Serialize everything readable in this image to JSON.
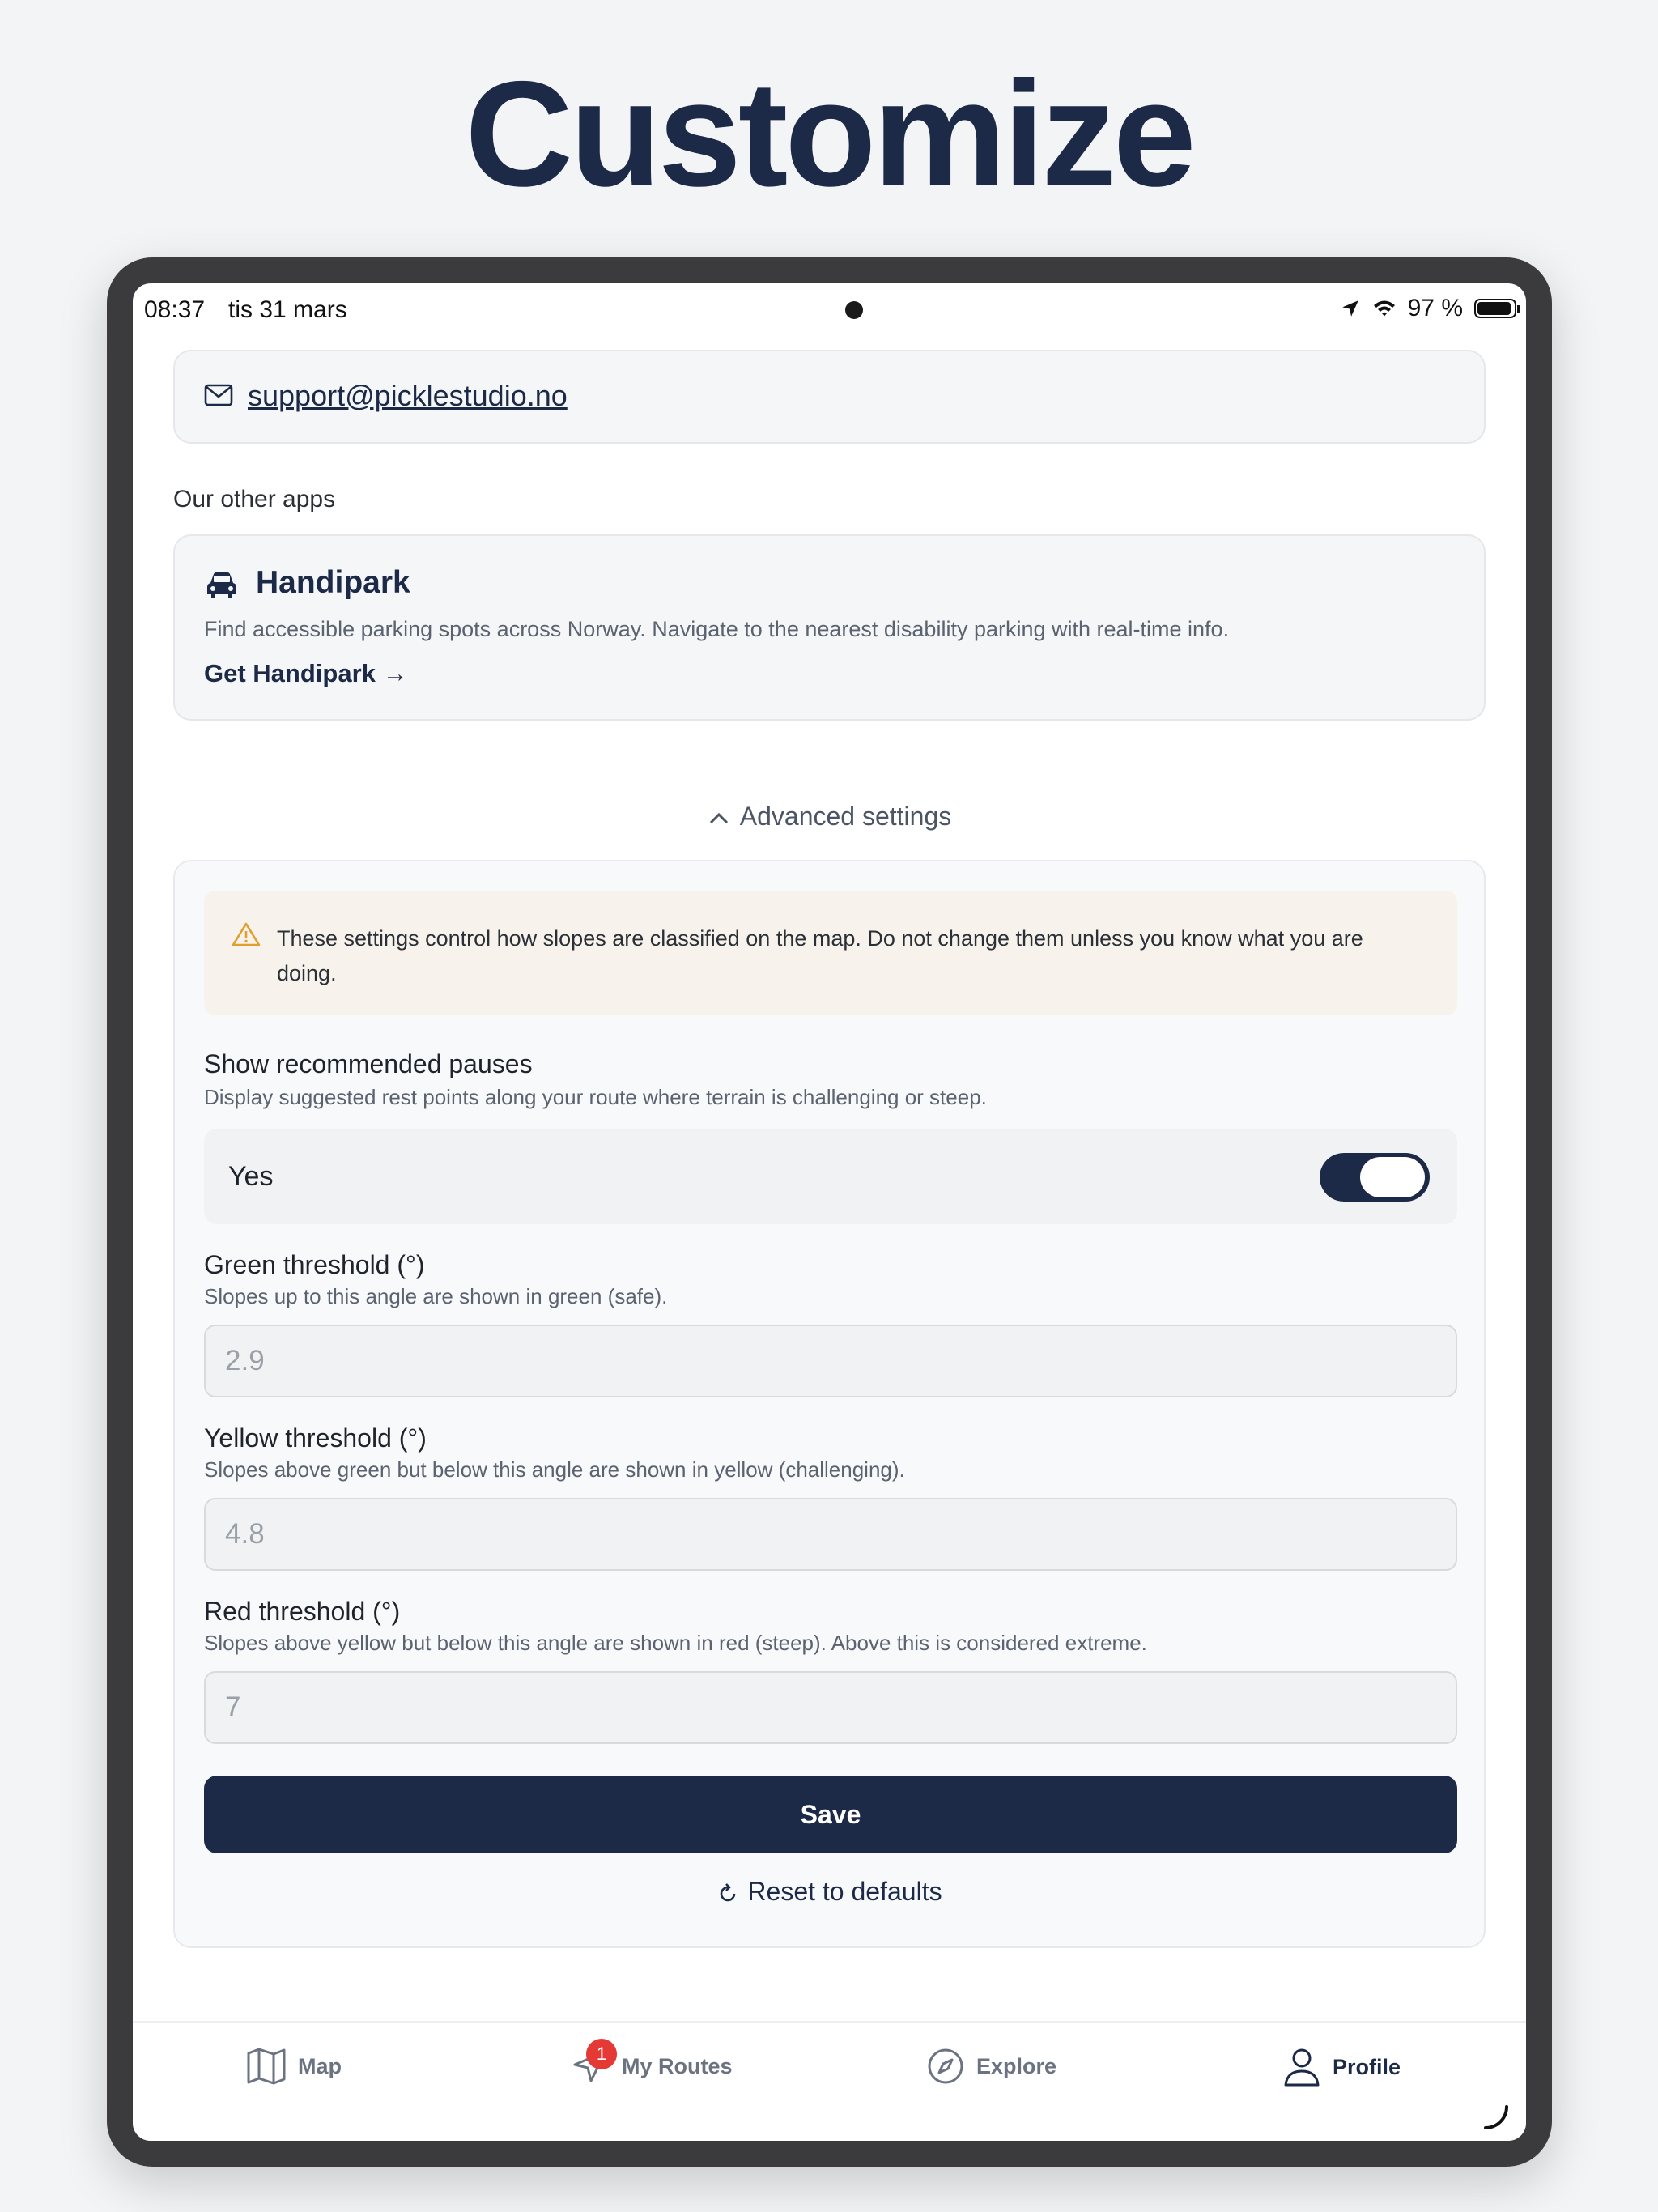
{
  "headline": "Customize",
  "status": {
    "time": "08:37",
    "date": "tis 31 mars",
    "battery": "97 %",
    "battery_level": 0.97
  },
  "contact": {
    "email": "support@picklestudio.no",
    "icon": "mail-icon"
  },
  "other_apps": {
    "label": "Our other apps",
    "app": {
      "name": "Handipark",
      "description": "Find accessible parking spots across Norway. Navigate to the nearest disability parking with real-time info.",
      "link": "Get Handipark →",
      "icon": "car-icon"
    }
  },
  "advanced": {
    "toggle_label": "Advanced settings",
    "warning": "These settings control how slopes are classified on the map. Do not change them unless you know what you are doing.",
    "pauses": {
      "label": "Show recommended pauses",
      "help": "Display suggested rest points along your route where terrain is challenging or steep.",
      "value_label": "Yes",
      "enabled": true
    },
    "green": {
      "label": "Green threshold (°)",
      "help": "Slopes up to this angle are shown in green (safe).",
      "value": "2.9"
    },
    "yellow": {
      "label": "Yellow threshold (°)",
      "help": "Slopes above green but below this angle are shown in yellow (challenging).",
      "value": "4.8"
    },
    "red": {
      "label": "Red threshold (°)",
      "help": "Slopes above yellow but below this angle are shown in red (steep). Above this is considered extreme.",
      "value": "7"
    },
    "save_label": "Save",
    "reset_label": "Reset to defaults"
  },
  "tabs": [
    {
      "label": "Map",
      "icon": "map-icon"
    },
    {
      "label": "My Routes",
      "icon": "navigation-icon",
      "badge": "1"
    },
    {
      "label": "Explore",
      "icon": "compass-icon"
    },
    {
      "label": "Profile",
      "icon": "user-icon",
      "active": true
    }
  ],
  "colors": {
    "primary": "#1c2a48",
    "warning_bg": "#f7f2ec",
    "warning_icon": "#e0a030",
    "badge": "#e53935"
  }
}
